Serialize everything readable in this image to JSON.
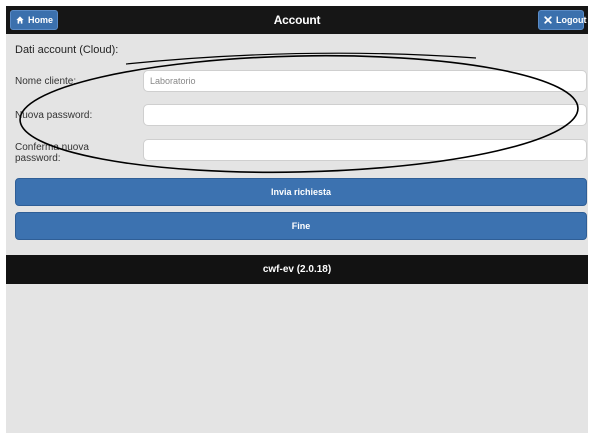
{
  "header": {
    "title": "Account",
    "home_label": "Home",
    "logout_label": "Logout"
  },
  "form": {
    "section_label": "Dati account (Cloud):",
    "fields": [
      {
        "label": "Nome cliente:",
        "value": "Laboratorio",
        "placeholder": ""
      },
      {
        "label": "Nuova password:",
        "value": "",
        "placeholder": ""
      },
      {
        "label": "Conferma nuova password:",
        "value": "",
        "placeholder": ""
      }
    ]
  },
  "buttons": {
    "submit_label": "Invia richiesta",
    "done_label": "Fine"
  },
  "footer": {
    "version_text": "cwf-ev (2.0.18)"
  },
  "colors": {
    "header_bg": "#161616",
    "button_blue": "#3c72b0",
    "page_bg": "#e4e4e4"
  }
}
